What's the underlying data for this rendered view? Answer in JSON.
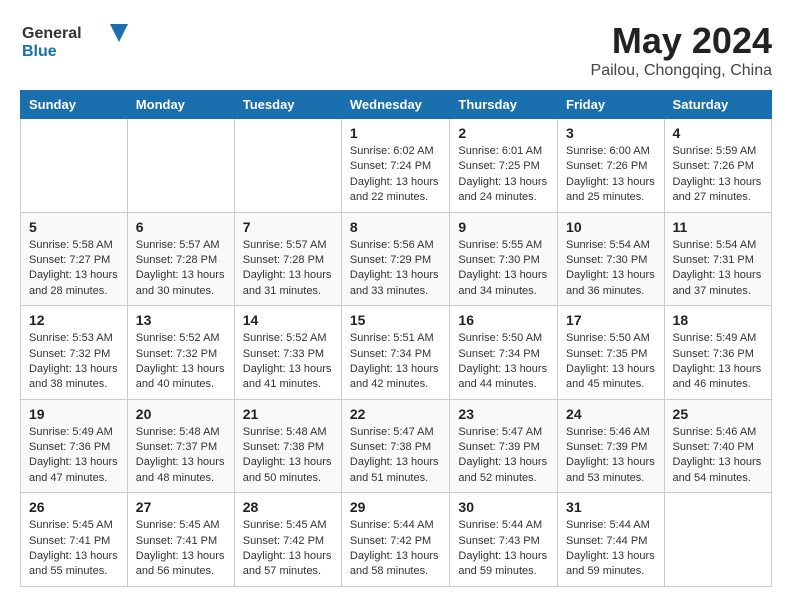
{
  "header": {
    "logo_general": "General",
    "logo_blue": "Blue",
    "month_title": "May 2024",
    "location": "Pailou, Chongqing, China"
  },
  "days_of_week": [
    "Sunday",
    "Monday",
    "Tuesday",
    "Wednesday",
    "Thursday",
    "Friday",
    "Saturday"
  ],
  "weeks": [
    [
      {
        "day": "",
        "info": ""
      },
      {
        "day": "",
        "info": ""
      },
      {
        "day": "",
        "info": ""
      },
      {
        "day": "1",
        "info": "Sunrise: 6:02 AM\nSunset: 7:24 PM\nDaylight: 13 hours and 22 minutes."
      },
      {
        "day": "2",
        "info": "Sunrise: 6:01 AM\nSunset: 7:25 PM\nDaylight: 13 hours and 24 minutes."
      },
      {
        "day": "3",
        "info": "Sunrise: 6:00 AM\nSunset: 7:26 PM\nDaylight: 13 hours and 25 minutes."
      },
      {
        "day": "4",
        "info": "Sunrise: 5:59 AM\nSunset: 7:26 PM\nDaylight: 13 hours and 27 minutes."
      }
    ],
    [
      {
        "day": "5",
        "info": "Sunrise: 5:58 AM\nSunset: 7:27 PM\nDaylight: 13 hours and 28 minutes."
      },
      {
        "day": "6",
        "info": "Sunrise: 5:57 AM\nSunset: 7:28 PM\nDaylight: 13 hours and 30 minutes."
      },
      {
        "day": "7",
        "info": "Sunrise: 5:57 AM\nSunset: 7:28 PM\nDaylight: 13 hours and 31 minutes."
      },
      {
        "day": "8",
        "info": "Sunrise: 5:56 AM\nSunset: 7:29 PM\nDaylight: 13 hours and 33 minutes."
      },
      {
        "day": "9",
        "info": "Sunrise: 5:55 AM\nSunset: 7:30 PM\nDaylight: 13 hours and 34 minutes."
      },
      {
        "day": "10",
        "info": "Sunrise: 5:54 AM\nSunset: 7:30 PM\nDaylight: 13 hours and 36 minutes."
      },
      {
        "day": "11",
        "info": "Sunrise: 5:54 AM\nSunset: 7:31 PM\nDaylight: 13 hours and 37 minutes."
      }
    ],
    [
      {
        "day": "12",
        "info": "Sunrise: 5:53 AM\nSunset: 7:32 PM\nDaylight: 13 hours and 38 minutes."
      },
      {
        "day": "13",
        "info": "Sunrise: 5:52 AM\nSunset: 7:32 PM\nDaylight: 13 hours and 40 minutes."
      },
      {
        "day": "14",
        "info": "Sunrise: 5:52 AM\nSunset: 7:33 PM\nDaylight: 13 hours and 41 minutes."
      },
      {
        "day": "15",
        "info": "Sunrise: 5:51 AM\nSunset: 7:34 PM\nDaylight: 13 hours and 42 minutes."
      },
      {
        "day": "16",
        "info": "Sunrise: 5:50 AM\nSunset: 7:34 PM\nDaylight: 13 hours and 44 minutes."
      },
      {
        "day": "17",
        "info": "Sunrise: 5:50 AM\nSunset: 7:35 PM\nDaylight: 13 hours and 45 minutes."
      },
      {
        "day": "18",
        "info": "Sunrise: 5:49 AM\nSunset: 7:36 PM\nDaylight: 13 hours and 46 minutes."
      }
    ],
    [
      {
        "day": "19",
        "info": "Sunrise: 5:49 AM\nSunset: 7:36 PM\nDaylight: 13 hours and 47 minutes."
      },
      {
        "day": "20",
        "info": "Sunrise: 5:48 AM\nSunset: 7:37 PM\nDaylight: 13 hours and 48 minutes."
      },
      {
        "day": "21",
        "info": "Sunrise: 5:48 AM\nSunset: 7:38 PM\nDaylight: 13 hours and 50 minutes."
      },
      {
        "day": "22",
        "info": "Sunrise: 5:47 AM\nSunset: 7:38 PM\nDaylight: 13 hours and 51 minutes."
      },
      {
        "day": "23",
        "info": "Sunrise: 5:47 AM\nSunset: 7:39 PM\nDaylight: 13 hours and 52 minutes."
      },
      {
        "day": "24",
        "info": "Sunrise: 5:46 AM\nSunset: 7:39 PM\nDaylight: 13 hours and 53 minutes."
      },
      {
        "day": "25",
        "info": "Sunrise: 5:46 AM\nSunset: 7:40 PM\nDaylight: 13 hours and 54 minutes."
      }
    ],
    [
      {
        "day": "26",
        "info": "Sunrise: 5:45 AM\nSunset: 7:41 PM\nDaylight: 13 hours and 55 minutes."
      },
      {
        "day": "27",
        "info": "Sunrise: 5:45 AM\nSunset: 7:41 PM\nDaylight: 13 hours and 56 minutes."
      },
      {
        "day": "28",
        "info": "Sunrise: 5:45 AM\nSunset: 7:42 PM\nDaylight: 13 hours and 57 minutes."
      },
      {
        "day": "29",
        "info": "Sunrise: 5:44 AM\nSunset: 7:42 PM\nDaylight: 13 hours and 58 minutes."
      },
      {
        "day": "30",
        "info": "Sunrise: 5:44 AM\nSunset: 7:43 PM\nDaylight: 13 hours and 59 minutes."
      },
      {
        "day": "31",
        "info": "Sunrise: 5:44 AM\nSunset: 7:44 PM\nDaylight: 13 hours and 59 minutes."
      },
      {
        "day": "",
        "info": ""
      }
    ]
  ]
}
